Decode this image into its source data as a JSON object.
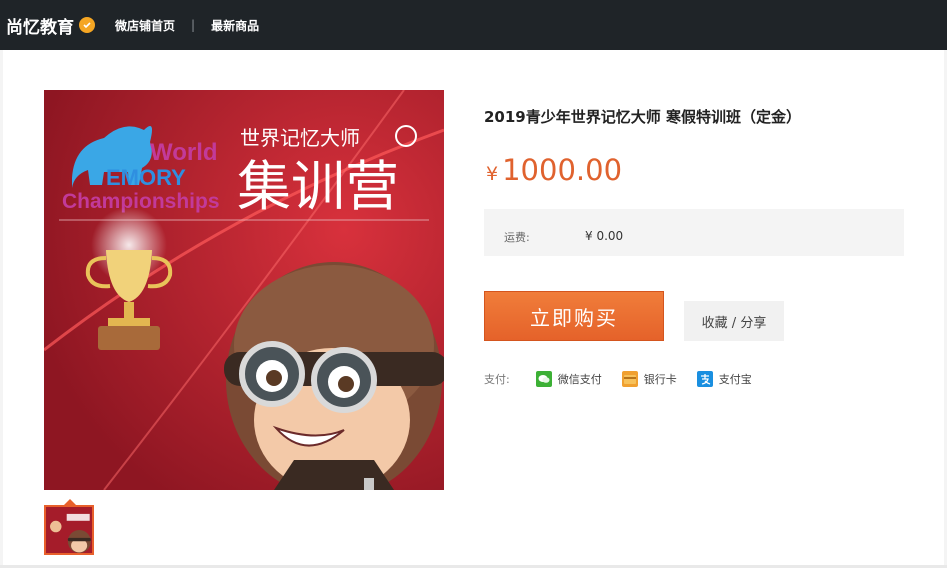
{
  "header": {
    "brand_name": "尚忆教育",
    "nav": [
      {
        "label": "微店铺首页"
      },
      {
        "label": "最新商品"
      }
    ],
    "separator": "|"
  },
  "product": {
    "title": "2019青少年世界记忆大师 寒假特训班（定金）",
    "price_currency": "¥",
    "price_amount": "1000.00",
    "shipping": {
      "label": "运费:",
      "value": "¥ 0.00"
    },
    "buy_button": "立即购买",
    "fav_share_button": "收藏 / 分享",
    "payment": {
      "label": "支付:",
      "methods": [
        {
          "label": "微信支付",
          "icon": "wechat-pay-icon",
          "color": "#3cb035"
        },
        {
          "label": "银行卡",
          "icon": "bank-card-icon",
          "color": "#f0a030"
        },
        {
          "label": "支付宝",
          "icon": "alipay-icon",
          "color": "#1a8fe0"
        }
      ]
    }
  },
  "image": {
    "world_text": "World",
    "memory_text": "EMORY",
    "championships_text": "Championships",
    "headline_small": "世界记忆大师",
    "headline_large": "集训营",
    "background_color": "#b51f2e",
    "accent_color": "#e0622e"
  }
}
